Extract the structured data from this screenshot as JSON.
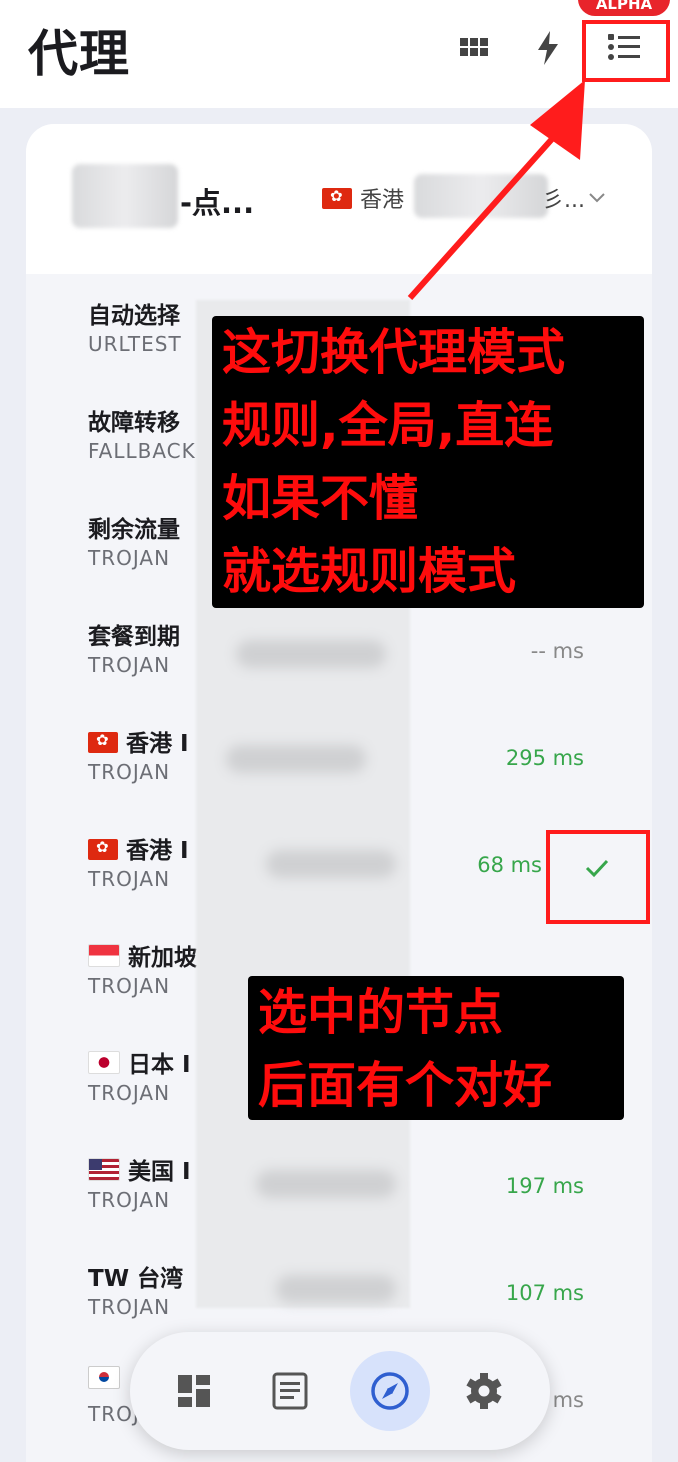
{
  "app": {
    "title": "代理",
    "alpha_badge": "ALPHA"
  },
  "toolbar": {
    "icons": [
      "grid-view-icon",
      "lightning-icon",
      "list-mode-icon"
    ]
  },
  "group": {
    "name_suffix": "-点...",
    "selected_flag": "hk",
    "selected_region": "香港",
    "selected_suffix": "彡..."
  },
  "proxies": [
    {
      "name": "自动选择",
      "type": "URLTEST",
      "latency": "",
      "flag": ""
    },
    {
      "name": "故障转移",
      "type": "FALLBACK",
      "latency": "",
      "flag": ""
    },
    {
      "name": "剩余流量",
      "type": "TROJAN",
      "latency": "",
      "flag": ""
    },
    {
      "name": "套餐到期",
      "type": "TROJAN",
      "latency": "-- ms",
      "flag": ""
    },
    {
      "name": "香港 I",
      "type": "TROJAN",
      "latency": "295 ms",
      "flag": "hk"
    },
    {
      "name": "香港 I",
      "type": "TROJAN",
      "latency": "68 ms",
      "flag": "hk",
      "selected": true
    },
    {
      "name": "新加坡",
      "type": "TROJAN",
      "latency": "",
      "flag": "sg"
    },
    {
      "name": "日本 I",
      "type": "TROJAN",
      "latency": "",
      "flag": "jp"
    },
    {
      "name": "美国 I",
      "type": "TROJAN",
      "latency": "197 ms",
      "flag": "us"
    },
    {
      "name": "TW 台湾",
      "type": "TROJAN",
      "latency": "107 ms",
      "flag": ""
    },
    {
      "name": "",
      "type": "TROJ",
      "latency": "ms",
      "flag": "kr"
    }
  ],
  "annotations": {
    "mode_note": "这切换代理模式\n规则,全局,直连\n如果不懂\n就选规则模式",
    "selected_note": "选中的节点\n后面有个对好"
  },
  "nav": {
    "items": [
      "dashboard-icon",
      "logs-icon",
      "proxies-compass-icon",
      "settings-gear-icon"
    ],
    "active_index": 2
  },
  "colors": {
    "latency_green": "#37a64b",
    "annotation_red": "#ff0c0c",
    "nav_active_bg": "#d7e2fb",
    "accent_blue": "#2f5fd0"
  }
}
